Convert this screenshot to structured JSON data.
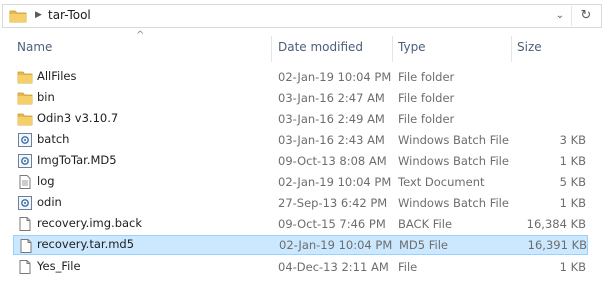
{
  "address_bar": {
    "path": "tar-Tool",
    "separator_icon": "chevron-right-icon",
    "dropdown_icon": "chevron-down-icon",
    "refresh_icon": "refresh-icon"
  },
  "columns": {
    "name": "Name",
    "date": "Date modified",
    "type": "Type",
    "size": "Size",
    "sort_icon": "sort-ascending-icon"
  },
  "files": [
    {
      "name": "AllFiles",
      "date": "02-Jan-19 10:04 PM",
      "type": "File folder",
      "size": "",
      "icon": "folder-icon"
    },
    {
      "name": "bin",
      "date": "03-Jan-16 2:47 AM",
      "type": "File folder",
      "size": "",
      "icon": "folder-icon"
    },
    {
      "name": "Odin3 v3.10.7",
      "date": "03-Jan-16 2:49 AM",
      "type": "File folder",
      "size": "",
      "icon": "folder-icon"
    },
    {
      "name": "batch",
      "date": "03-Jan-16 2:43 AM",
      "type": "Windows Batch File",
      "size": "3 KB",
      "icon": "batch-file-icon"
    },
    {
      "name": "ImgToTar.MD5",
      "date": "09-Oct-13 8:08 AM",
      "type": "Windows Batch File",
      "size": "1 KB",
      "icon": "batch-file-icon"
    },
    {
      "name": "log",
      "date": "02-Jan-19 10:04 PM",
      "type": "Text Document",
      "size": "5 KB",
      "icon": "text-document-icon"
    },
    {
      "name": "odin",
      "date": "27-Sep-13 6:42 PM",
      "type": "Windows Batch File",
      "size": "1 KB",
      "icon": "batch-file-icon"
    },
    {
      "name": "recovery.img.back",
      "date": "09-Oct-15 7:46 PM",
      "type": "BACK File",
      "size": "16,384 KB",
      "icon": "blank-file-icon"
    },
    {
      "name": "recovery.tar.md5",
      "date": "02-Jan-19 10:04 PM",
      "type": "MD5 File",
      "size": "16,391 KB",
      "icon": "blank-file-icon",
      "selected": true
    },
    {
      "name": "Yes_File",
      "date": "04-Dec-13 2:11 AM",
      "type": "File",
      "size": "1 KB",
      "icon": "blank-file-icon"
    }
  ],
  "colors": {
    "folder": "#e8b84a",
    "header_text": "#4c607a",
    "selection_bg": "#cce8ff",
    "selection_border": "#99d1ff"
  }
}
